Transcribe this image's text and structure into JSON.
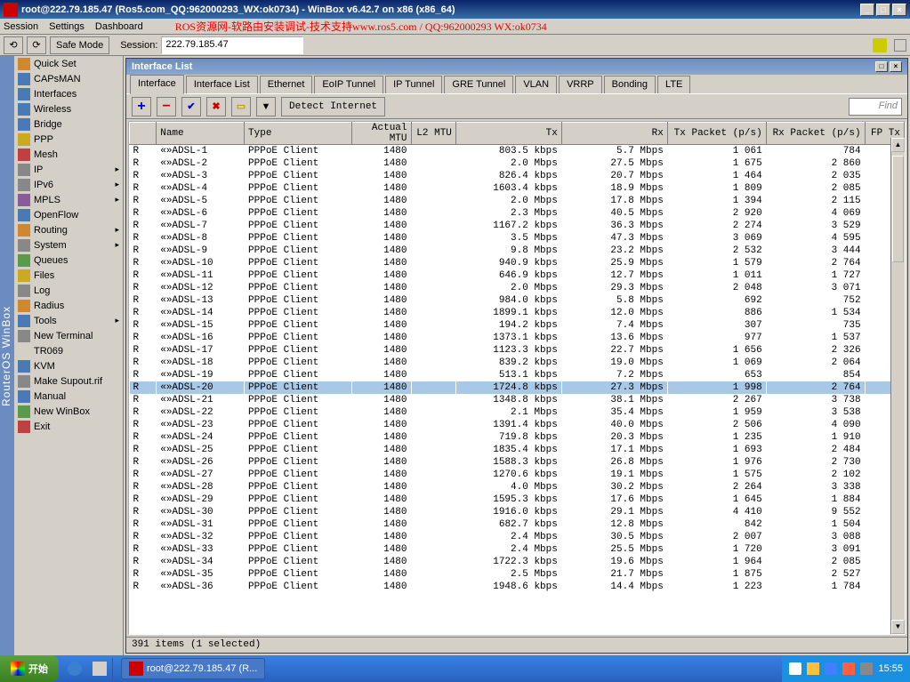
{
  "window": {
    "title": "root@222.79.185.47 (Ros5.com_QQ:962000293_WX:ok0734) - WinBox v6.42.7 on x86 (x86_64)"
  },
  "menubar": {
    "items": [
      "Session",
      "Settings",
      "Dashboard"
    ],
    "banner": "ROS资源网-软路由安装调试-技术支持www.ros5.com / QQ:962000293 WX:ok0734"
  },
  "toolbar": {
    "safe_mode": "Safe Mode",
    "session_label": "Session:",
    "session_value": "222.79.185.47"
  },
  "side_title": "RouterOS WinBox",
  "menu": {
    "items": [
      {
        "icon": "ic-org",
        "label": "Quick Set"
      },
      {
        "icon": "ic-blue",
        "label": "CAPsMAN"
      },
      {
        "icon": "ic-blue",
        "label": "Interfaces"
      },
      {
        "icon": "ic-blue",
        "label": "Wireless"
      },
      {
        "icon": "ic-blue",
        "label": "Bridge"
      },
      {
        "icon": "ic-yel",
        "label": "PPP"
      },
      {
        "icon": "ic-red",
        "label": "Mesh"
      },
      {
        "icon": "ic-gry",
        "label": "IP",
        "arrow": true
      },
      {
        "icon": "ic-gry",
        "label": "IPv6",
        "arrow": true
      },
      {
        "icon": "ic-pur",
        "label": "MPLS",
        "arrow": true
      },
      {
        "icon": "ic-blue",
        "label": "OpenFlow"
      },
      {
        "icon": "ic-org",
        "label": "Routing",
        "arrow": true
      },
      {
        "icon": "ic-gry",
        "label": "System",
        "arrow": true
      },
      {
        "icon": "ic-grn",
        "label": "Queues"
      },
      {
        "icon": "ic-yel",
        "label": "Files"
      },
      {
        "icon": "ic-gry",
        "label": "Log"
      },
      {
        "icon": "ic-org",
        "label": "Radius"
      },
      {
        "icon": "ic-blue",
        "label": "Tools",
        "arrow": true
      },
      {
        "icon": "ic-gry",
        "label": "New Terminal"
      },
      {
        "icon": "",
        "label": "TR069"
      },
      {
        "icon": "ic-blue",
        "label": "KVM"
      },
      {
        "icon": "ic-gry",
        "label": "Make Supout.rif"
      },
      {
        "icon": "ic-blue",
        "label": "Manual"
      },
      {
        "icon": "ic-grn",
        "label": "New WinBox"
      },
      {
        "icon": "ic-red",
        "label": "Exit"
      }
    ]
  },
  "iface": {
    "title": "Interface List",
    "tabs": [
      "Interface",
      "Interface List",
      "Ethernet",
      "EoIP Tunnel",
      "IP Tunnel",
      "GRE Tunnel",
      "VLAN",
      "VRRP",
      "Bonding",
      "LTE"
    ],
    "active_tab": 0,
    "detect_btn": "Detect Internet",
    "find_placeholder": "Find",
    "columns": [
      "",
      "Name",
      "Type",
      "Actual MTU",
      "L2 MTU",
      "Tx",
      "Rx",
      "Tx Packet (p/s)",
      "Rx Packet (p/s)",
      "FP Tx"
    ],
    "selected_row": 19,
    "status": "391 items (1 selected)",
    "rows": [
      {
        "f": "R",
        "n": "ADSL-1",
        "t": "PPPoE Client",
        "mtu": "1480",
        "l2": "",
        "tx": "803.5 kbps",
        "rx": "5.7 Mbps",
        "txp": "1 061",
        "rxp": "784"
      },
      {
        "f": "R",
        "n": "ADSL-2",
        "t": "PPPoE Client",
        "mtu": "1480",
        "l2": "",
        "tx": "2.0 Mbps",
        "rx": "27.5 Mbps",
        "txp": "1 675",
        "rxp": "2 860"
      },
      {
        "f": "R",
        "n": "ADSL-3",
        "t": "PPPoE Client",
        "mtu": "1480",
        "l2": "",
        "tx": "826.4 kbps",
        "rx": "20.7 Mbps",
        "txp": "1 464",
        "rxp": "2 035"
      },
      {
        "f": "R",
        "n": "ADSL-4",
        "t": "PPPoE Client",
        "mtu": "1480",
        "l2": "",
        "tx": "1603.4 kbps",
        "rx": "18.9 Mbps",
        "txp": "1 809",
        "rxp": "2 085"
      },
      {
        "f": "R",
        "n": "ADSL-5",
        "t": "PPPoE Client",
        "mtu": "1480",
        "l2": "",
        "tx": "2.0 Mbps",
        "rx": "17.8 Mbps",
        "txp": "1 394",
        "rxp": "2 115"
      },
      {
        "f": "R",
        "n": "ADSL-6",
        "t": "PPPoE Client",
        "mtu": "1480",
        "l2": "",
        "tx": "2.3 Mbps",
        "rx": "40.5 Mbps",
        "txp": "2 920",
        "rxp": "4 069"
      },
      {
        "f": "R",
        "n": "ADSL-7",
        "t": "PPPoE Client",
        "mtu": "1480",
        "l2": "",
        "tx": "1167.2 kbps",
        "rx": "36.3 Mbps",
        "txp": "2 274",
        "rxp": "3 529"
      },
      {
        "f": "R",
        "n": "ADSL-8",
        "t": "PPPoE Client",
        "mtu": "1480",
        "l2": "",
        "tx": "3.5 Mbps",
        "rx": "47.3 Mbps",
        "txp": "3 069",
        "rxp": "4 595"
      },
      {
        "f": "R",
        "n": "ADSL-9",
        "t": "PPPoE Client",
        "mtu": "1480",
        "l2": "",
        "tx": "9.8 Mbps",
        "rx": "23.2 Mbps",
        "txp": "2 532",
        "rxp": "3 444"
      },
      {
        "f": "R",
        "n": "ADSL-10",
        "t": "PPPoE Client",
        "mtu": "1480",
        "l2": "",
        "tx": "940.9 kbps",
        "rx": "25.9 Mbps",
        "txp": "1 579",
        "rxp": "2 764"
      },
      {
        "f": "R",
        "n": "ADSL-11",
        "t": "PPPoE Client",
        "mtu": "1480",
        "l2": "",
        "tx": "646.9 kbps",
        "rx": "12.7 Mbps",
        "txp": "1 011",
        "rxp": "1 727"
      },
      {
        "f": "R",
        "n": "ADSL-12",
        "t": "PPPoE Client",
        "mtu": "1480",
        "l2": "",
        "tx": "2.0 Mbps",
        "rx": "29.3 Mbps",
        "txp": "2 048",
        "rxp": "3 071"
      },
      {
        "f": "R",
        "n": "ADSL-13",
        "t": "PPPoE Client",
        "mtu": "1480",
        "l2": "",
        "tx": "984.0 kbps",
        "rx": "5.8 Mbps",
        "txp": "692",
        "rxp": "752"
      },
      {
        "f": "R",
        "n": "ADSL-14",
        "t": "PPPoE Client",
        "mtu": "1480",
        "l2": "",
        "tx": "1899.1 kbps",
        "rx": "12.0 Mbps",
        "txp": "886",
        "rxp": "1 534"
      },
      {
        "f": "R",
        "n": "ADSL-15",
        "t": "PPPoE Client",
        "mtu": "1480",
        "l2": "",
        "tx": "194.2 kbps",
        "rx": "7.4 Mbps",
        "txp": "307",
        "rxp": "735"
      },
      {
        "f": "R",
        "n": "ADSL-16",
        "t": "PPPoE Client",
        "mtu": "1480",
        "l2": "",
        "tx": "1373.1 kbps",
        "rx": "13.6 Mbps",
        "txp": "977",
        "rxp": "1 537"
      },
      {
        "f": "R",
        "n": "ADSL-17",
        "t": "PPPoE Client",
        "mtu": "1480",
        "l2": "",
        "tx": "1123.3 kbps",
        "rx": "22.7 Mbps",
        "txp": "1 656",
        "rxp": "2 326"
      },
      {
        "f": "R",
        "n": "ADSL-18",
        "t": "PPPoE Client",
        "mtu": "1480",
        "l2": "",
        "tx": "839.2 kbps",
        "rx": "19.0 Mbps",
        "txp": "1 069",
        "rxp": "2 064"
      },
      {
        "f": "R",
        "n": "ADSL-19",
        "t": "PPPoE Client",
        "mtu": "1480",
        "l2": "",
        "tx": "513.1 kbps",
        "rx": "7.2 Mbps",
        "txp": "653",
        "rxp": "854"
      },
      {
        "f": "R",
        "n": "ADSL-20",
        "t": "PPPoE Client",
        "mtu": "1480",
        "l2": "",
        "tx": "1724.8 kbps",
        "rx": "27.3 Mbps",
        "txp": "1 998",
        "rxp": "2 764"
      },
      {
        "f": "R",
        "n": "ADSL-21",
        "t": "PPPoE Client",
        "mtu": "1480",
        "l2": "",
        "tx": "1348.8 kbps",
        "rx": "38.1 Mbps",
        "txp": "2 267",
        "rxp": "3 738"
      },
      {
        "f": "R",
        "n": "ADSL-22",
        "t": "PPPoE Client",
        "mtu": "1480",
        "l2": "",
        "tx": "2.1 Mbps",
        "rx": "35.4 Mbps",
        "txp": "1 959",
        "rxp": "3 538"
      },
      {
        "f": "R",
        "n": "ADSL-23",
        "t": "PPPoE Client",
        "mtu": "1480",
        "l2": "",
        "tx": "1391.4 kbps",
        "rx": "40.0 Mbps",
        "txp": "2 506",
        "rxp": "4 090"
      },
      {
        "f": "R",
        "n": "ADSL-24",
        "t": "PPPoE Client",
        "mtu": "1480",
        "l2": "",
        "tx": "719.8 kbps",
        "rx": "20.3 Mbps",
        "txp": "1 235",
        "rxp": "1 910"
      },
      {
        "f": "R",
        "n": "ADSL-25",
        "t": "PPPoE Client",
        "mtu": "1480",
        "l2": "",
        "tx": "1835.4 kbps",
        "rx": "17.1 Mbps",
        "txp": "1 693",
        "rxp": "2 484"
      },
      {
        "f": "R",
        "n": "ADSL-26",
        "t": "PPPoE Client",
        "mtu": "1480",
        "l2": "",
        "tx": "1588.3 kbps",
        "rx": "26.8 Mbps",
        "txp": "1 976",
        "rxp": "2 730"
      },
      {
        "f": "R",
        "n": "ADSL-27",
        "t": "PPPoE Client",
        "mtu": "1480",
        "l2": "",
        "tx": "1270.6 kbps",
        "rx": "19.1 Mbps",
        "txp": "1 575",
        "rxp": "2 102"
      },
      {
        "f": "R",
        "n": "ADSL-28",
        "t": "PPPoE Client",
        "mtu": "1480",
        "l2": "",
        "tx": "4.0 Mbps",
        "rx": "30.2 Mbps",
        "txp": "2 264",
        "rxp": "3 338"
      },
      {
        "f": "R",
        "n": "ADSL-29",
        "t": "PPPoE Client",
        "mtu": "1480",
        "l2": "",
        "tx": "1595.3 kbps",
        "rx": "17.6 Mbps",
        "txp": "1 645",
        "rxp": "1 884"
      },
      {
        "f": "R",
        "n": "ADSL-30",
        "t": "PPPoE Client",
        "mtu": "1480",
        "l2": "",
        "tx": "1916.0 kbps",
        "rx": "29.1 Mbps",
        "txp": "4 410",
        "rxp": "9 552"
      },
      {
        "f": "R",
        "n": "ADSL-31",
        "t": "PPPoE Client",
        "mtu": "1480",
        "l2": "",
        "tx": "682.7 kbps",
        "rx": "12.8 Mbps",
        "txp": "842",
        "rxp": "1 504"
      },
      {
        "f": "R",
        "n": "ADSL-32",
        "t": "PPPoE Client",
        "mtu": "1480",
        "l2": "",
        "tx": "2.4 Mbps",
        "rx": "30.5 Mbps",
        "txp": "2 007",
        "rxp": "3 088"
      },
      {
        "f": "R",
        "n": "ADSL-33",
        "t": "PPPoE Client",
        "mtu": "1480",
        "l2": "",
        "tx": "2.4 Mbps",
        "rx": "25.5 Mbps",
        "txp": "1 720",
        "rxp": "3 091"
      },
      {
        "f": "R",
        "n": "ADSL-34",
        "t": "PPPoE Client",
        "mtu": "1480",
        "l2": "",
        "tx": "1722.3 kbps",
        "rx": "19.6 Mbps",
        "txp": "1 964",
        "rxp": "2 085"
      },
      {
        "f": "R",
        "n": "ADSL-35",
        "t": "PPPoE Client",
        "mtu": "1480",
        "l2": "",
        "tx": "2.5 Mbps",
        "rx": "21.7 Mbps",
        "txp": "1 875",
        "rxp": "2 527"
      },
      {
        "f": "R",
        "n": "ADSL-36",
        "t": "PPPoE Client",
        "mtu": "1480",
        "l2": "",
        "tx": "1948.6 kbps",
        "rx": "14.4 Mbps",
        "txp": "1 223",
        "rxp": "1 784"
      }
    ]
  },
  "taskbar": {
    "start": "开始",
    "task": "root@222.79.185.47 (R...",
    "clock": "15:55"
  }
}
